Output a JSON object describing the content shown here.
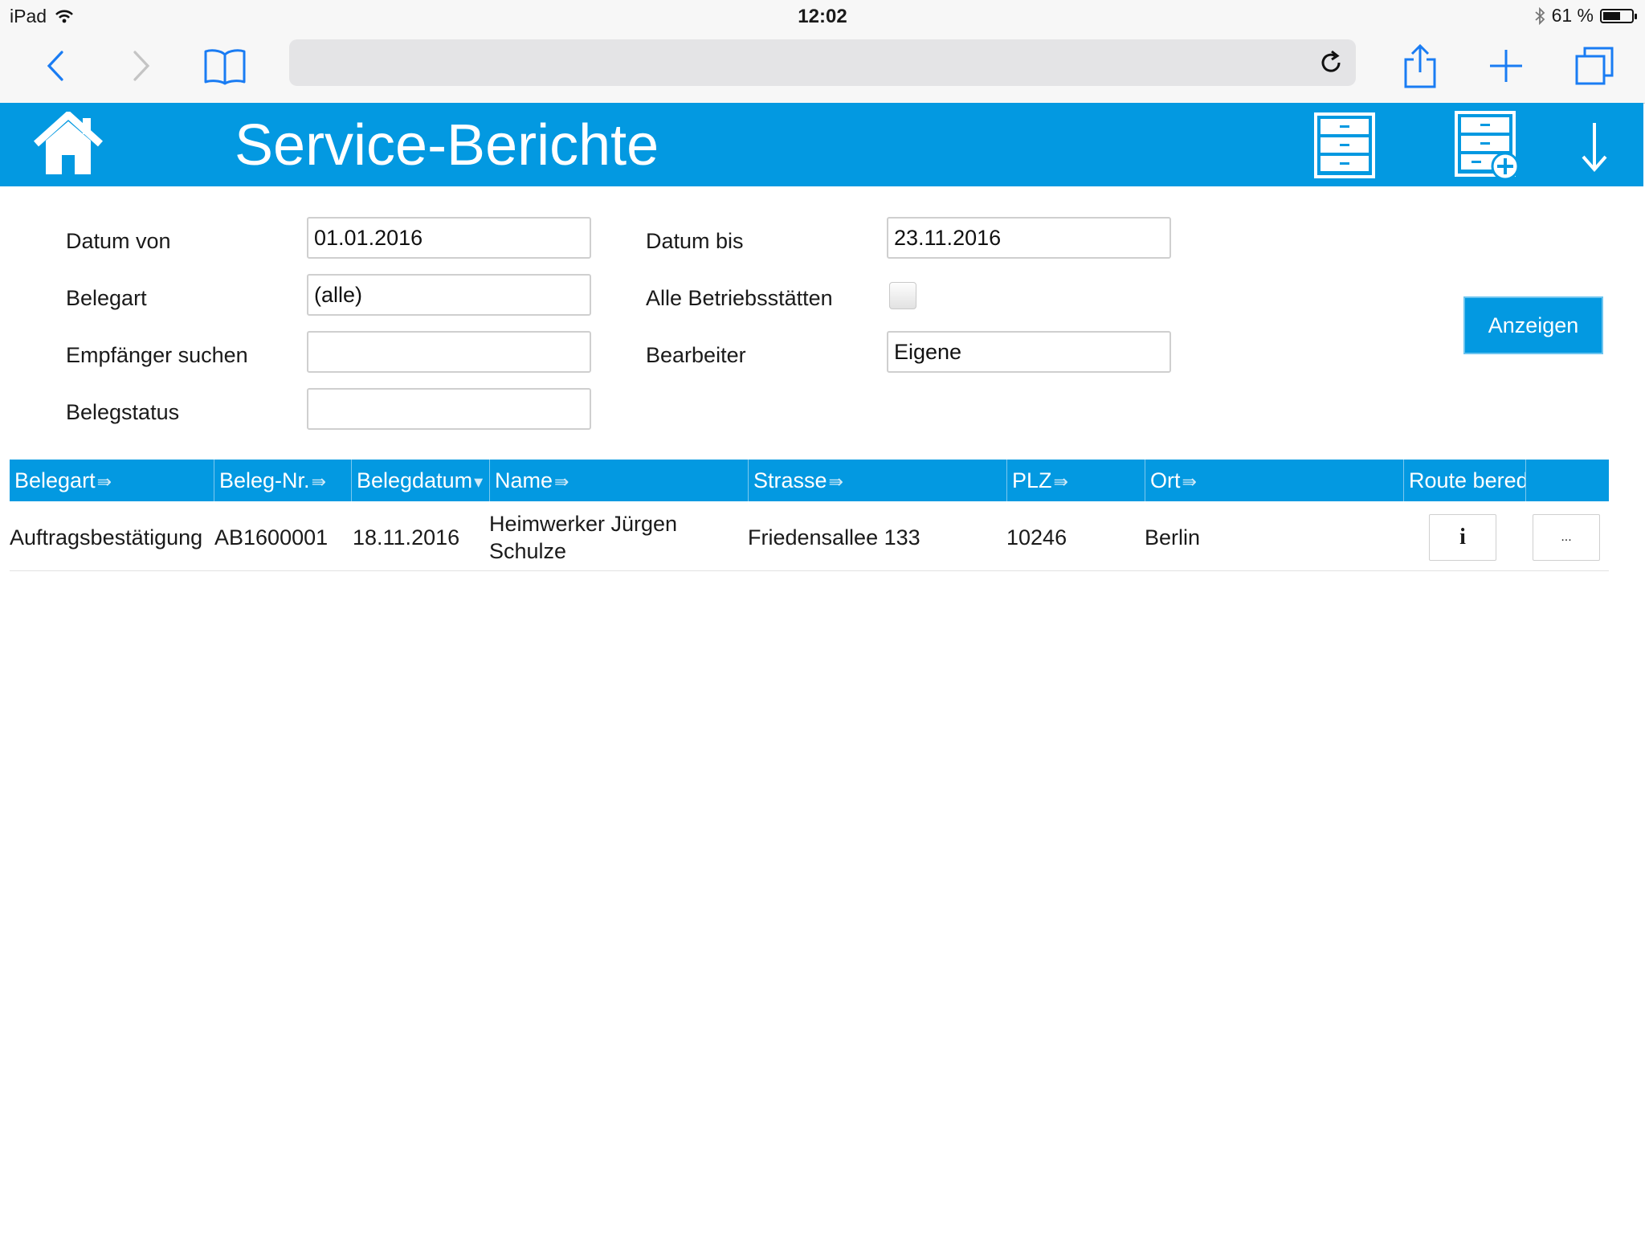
{
  "status_bar": {
    "device": "iPad",
    "time": "12:02",
    "battery_percent": "61 %",
    "battery_level": 0.61
  },
  "safari": {
    "url": "",
    "icons": [
      "back-icon",
      "forward-icon",
      "bookmarks-icon",
      "reload-icon",
      "share-icon",
      "new-tab-icon",
      "tabs-icon"
    ]
  },
  "header": {
    "title": "Service-Berichte",
    "icons": [
      "home-icon",
      "cabinet-icon",
      "cabinet-add-icon",
      "download-arrow-icon"
    ]
  },
  "filters": {
    "datum_von": {
      "label": "Datum von",
      "value": "01.01.2016"
    },
    "datum_bis": {
      "label": "Datum bis",
      "value": "23.11.2016"
    },
    "belegart": {
      "label": "Belegart",
      "value": "(alle)"
    },
    "alle_betriebsstaetten": {
      "label": "Alle Betriebsstätten",
      "checked": false
    },
    "empfaenger": {
      "label": "Empfänger suchen",
      "value": ""
    },
    "bearbeiter": {
      "label": "Bearbeiter",
      "value": "Eigene"
    },
    "belegstatus": {
      "label": "Belegstatus",
      "value": ""
    },
    "show_button": "Anzeigen"
  },
  "table": {
    "columns": [
      {
        "label": "Belegart",
        "sort": "⇛"
      },
      {
        "label": "Beleg-Nr.",
        "sort": "⇛"
      },
      {
        "label": "Belegdatum",
        "sort": "▾"
      },
      {
        "label": "Name",
        "sort": "⇛"
      },
      {
        "label": "Strasse",
        "sort": "⇛"
      },
      {
        "label": "PLZ",
        "sort": "⇛"
      },
      {
        "label": "Ort",
        "sort": "⇛"
      },
      {
        "label": "Route bered",
        "sort": ""
      },
      {
        "label": "",
        "sort": ""
      }
    ],
    "rows": [
      {
        "belegart": "Auftragsbestätigung",
        "beleg_nr": "AB1600001",
        "belegdatum": "18.11.2016",
        "name_line1": "Heimwerker Jürgen",
        "name_line2": "Schulze",
        "strasse": "Friedensallee 133",
        "plz": "10246",
        "ort": "Berlin",
        "info_label": "i",
        "more_label": "..."
      }
    ]
  },
  "colors": {
    "accent": "#0399e1",
    "ios_blue": "#1a7cf3"
  }
}
